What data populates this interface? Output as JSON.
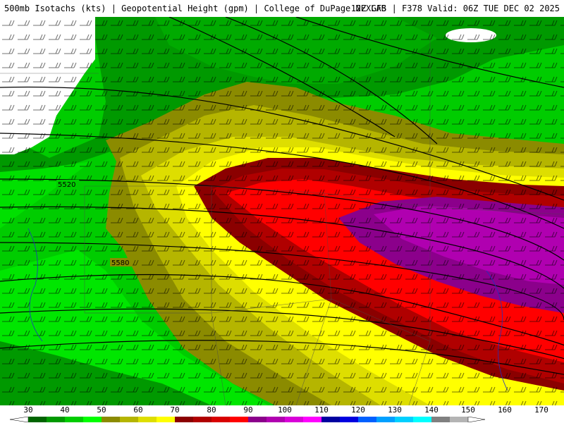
{
  "header": {
    "left_title": "500mb Isotachs (kts) | Geopotential Height (gpm) | College of DuPage NEXLAB",
    "right_title": "12Z GFS | F378 Valid: 06Z TUE DEC 02 2025"
  },
  "map": {
    "contour_labels": [
      "5520",
      "5580"
    ]
  },
  "legend": {
    "tick_labels": [
      "30",
      "40",
      "50",
      "60",
      "70",
      "80",
      "90",
      "100",
      "110",
      "120",
      "130",
      "140",
      "150",
      "160",
      "170"
    ],
    "colors": [
      "#006400",
      "#009900",
      "#00cc00",
      "#00ff00",
      "#8b8b00",
      "#b5b500",
      "#dede00",
      "#ffff00",
      "#8b0000",
      "#b00000",
      "#d80000",
      "#ff0000",
      "#8b008b",
      "#b000b0",
      "#d800d8",
      "#ff00ff",
      "#0000a0",
      "#0000e0",
      "#0060ff",
      "#00a0ff",
      "#00d0ff",
      "#00ffff",
      "#808080",
      "#b4b4b4"
    ]
  }
}
